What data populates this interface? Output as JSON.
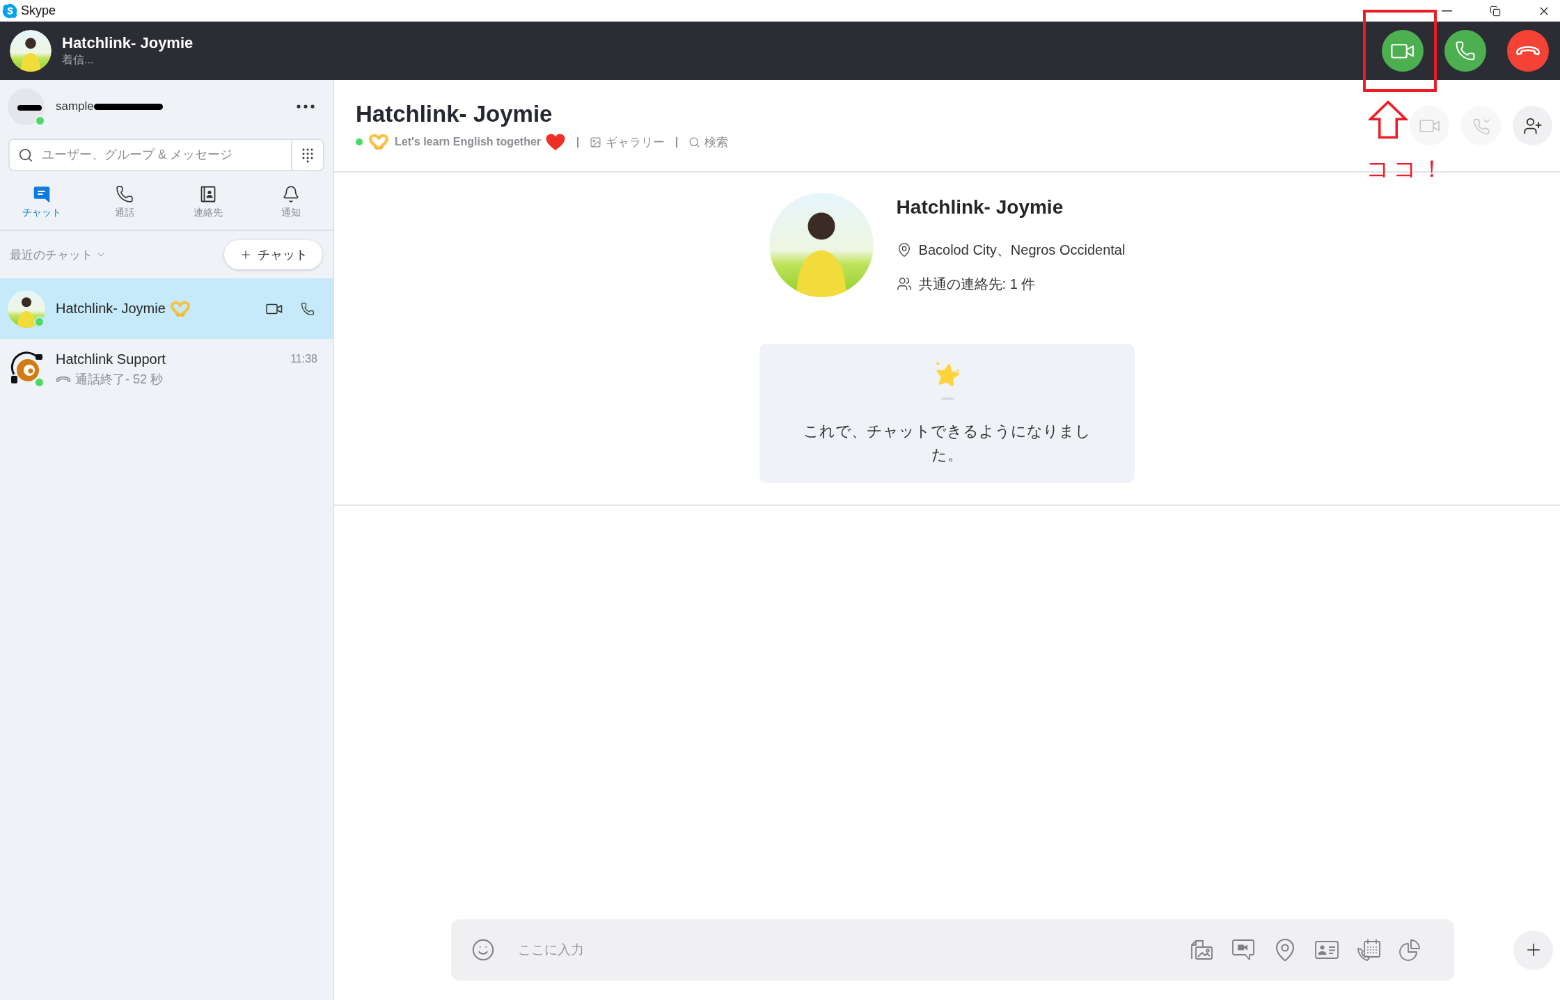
{
  "window": {
    "title": "Skype"
  },
  "incoming_call": {
    "name": "Hatchlink- Joymie",
    "status": "着信..."
  },
  "account": {
    "name": "sample",
    "online": true
  },
  "search": {
    "placeholder": "ユーザー、グループ & メッセージ"
  },
  "nav_tabs": [
    {
      "kind": "chat",
      "label": "チャット",
      "selected": true
    },
    {
      "kind": "calls",
      "label": "通話",
      "selected": false
    },
    {
      "kind": "contacts",
      "label": "連絡先",
      "selected": false
    },
    {
      "kind": "notifications",
      "label": "通知",
      "selected": false
    }
  ],
  "recent": {
    "label": "最近のチャット",
    "new_chat_button": "チャット"
  },
  "chats": [
    {
      "kind": "photo",
      "name": "Hatchlink- Joymie",
      "emoji": true,
      "online": true,
      "selected": true
    },
    {
      "kind": "logo",
      "name": "Hatchlink Support",
      "emoji": false,
      "online": true,
      "selected": false,
      "time": "11:38",
      "preview": {
        "kind": "call_ended",
        "text": "通話終了- 52 秒"
      }
    }
  ],
  "chat_header": {
    "title": "Hatchlink- Joymie",
    "online": true,
    "mood": "Let's learn English together",
    "links": [
      {
        "kind": "gallery",
        "label": "ギャラリー"
      },
      {
        "kind": "search",
        "label": "検索"
      }
    ],
    "actions": [
      {
        "kind": "video",
        "disabled": true
      },
      {
        "kind": "call",
        "disabled": true
      },
      {
        "kind": "add_person",
        "disabled": false
      }
    ]
  },
  "profile": {
    "name": "Hatchlink- Joymie",
    "location": "Bacolod City、Negros Occidental",
    "mutual_contacts": "共通の連絡先: 1 件"
  },
  "welcome_card": {
    "message": "これで、チャットできるようになりました。"
  },
  "composer": {
    "placeholder": "ここに入力"
  },
  "annotation": {
    "text": "ココ！"
  }
}
